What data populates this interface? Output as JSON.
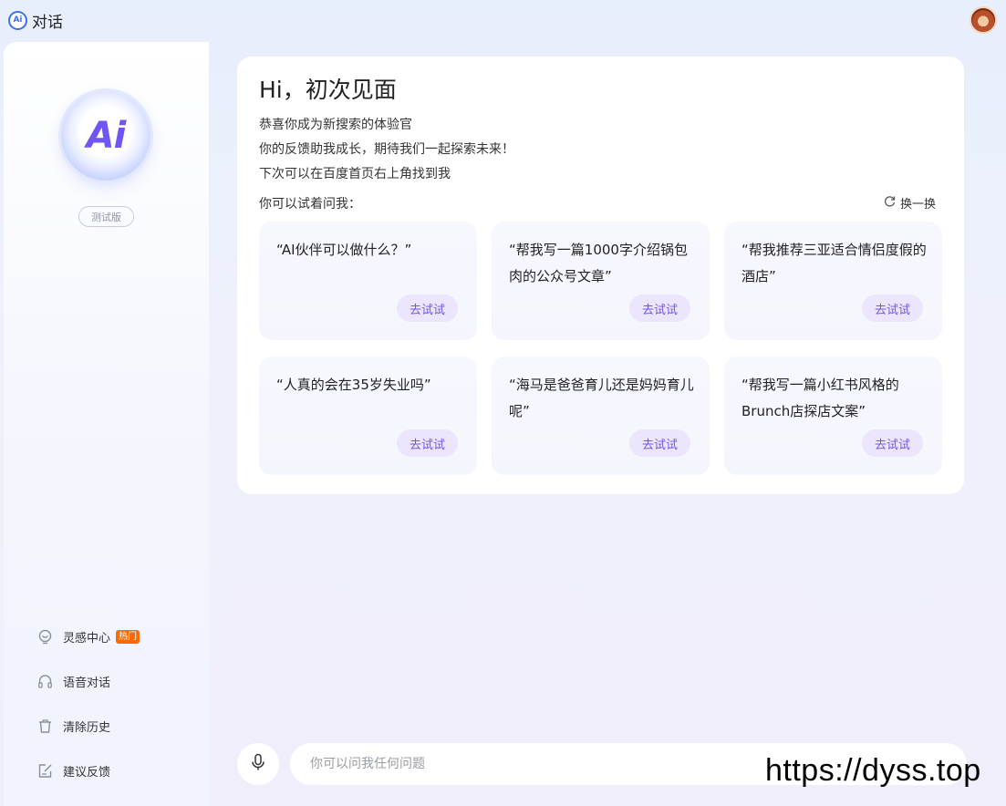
{
  "window": {
    "logo_text": "Ai",
    "title": "对话"
  },
  "sidebar": {
    "badge_text": "Ai",
    "beta_label": "测试版",
    "items": [
      {
        "label": "灵感中心",
        "icon": "lightbulb-icon",
        "tag": "热门"
      },
      {
        "label": "语音对话",
        "icon": "headphones-icon"
      },
      {
        "label": "清除历史",
        "icon": "trash-icon"
      },
      {
        "label": "建议反馈",
        "icon": "feedback-edit-icon"
      }
    ]
  },
  "main": {
    "greeting": "Hi，初次见面",
    "intro_lines": [
      "恭喜你成为新搜索的体验官",
      "你的反馈助我成长，期待我们一起探索未来！",
      "下次可以在百度首页右上角找到我"
    ],
    "try_label": "你可以试着问我：",
    "refresh_label": "换一换",
    "suggestions": [
      {
        "text": "“AI伙伴可以做什么？”",
        "button": "去试试"
      },
      {
        "text": "“帮我写一篇1000字介绍锅包肉的公众号文章”",
        "button": "去试试"
      },
      {
        "text": "“帮我推荐三亚适合情侣度假的酒店”",
        "button": "去试试"
      },
      {
        "text": "“人真的会在35岁失业吗”",
        "button": "去试试"
      },
      {
        "text": "“海马是爸爸育儿还是妈妈育儿呢”",
        "button": "去试试"
      },
      {
        "text": "“帮我写一篇小红书风格的Brunch店探店文案”",
        "button": "去试试"
      }
    ]
  },
  "input": {
    "placeholder": "你可以问我任何问题",
    "value": ""
  },
  "watermark": "https://dyss.top",
  "colors": {
    "accent": "#7454e8",
    "button_bg": "#ebe6fd",
    "hot_tag": "#ff6a00"
  }
}
